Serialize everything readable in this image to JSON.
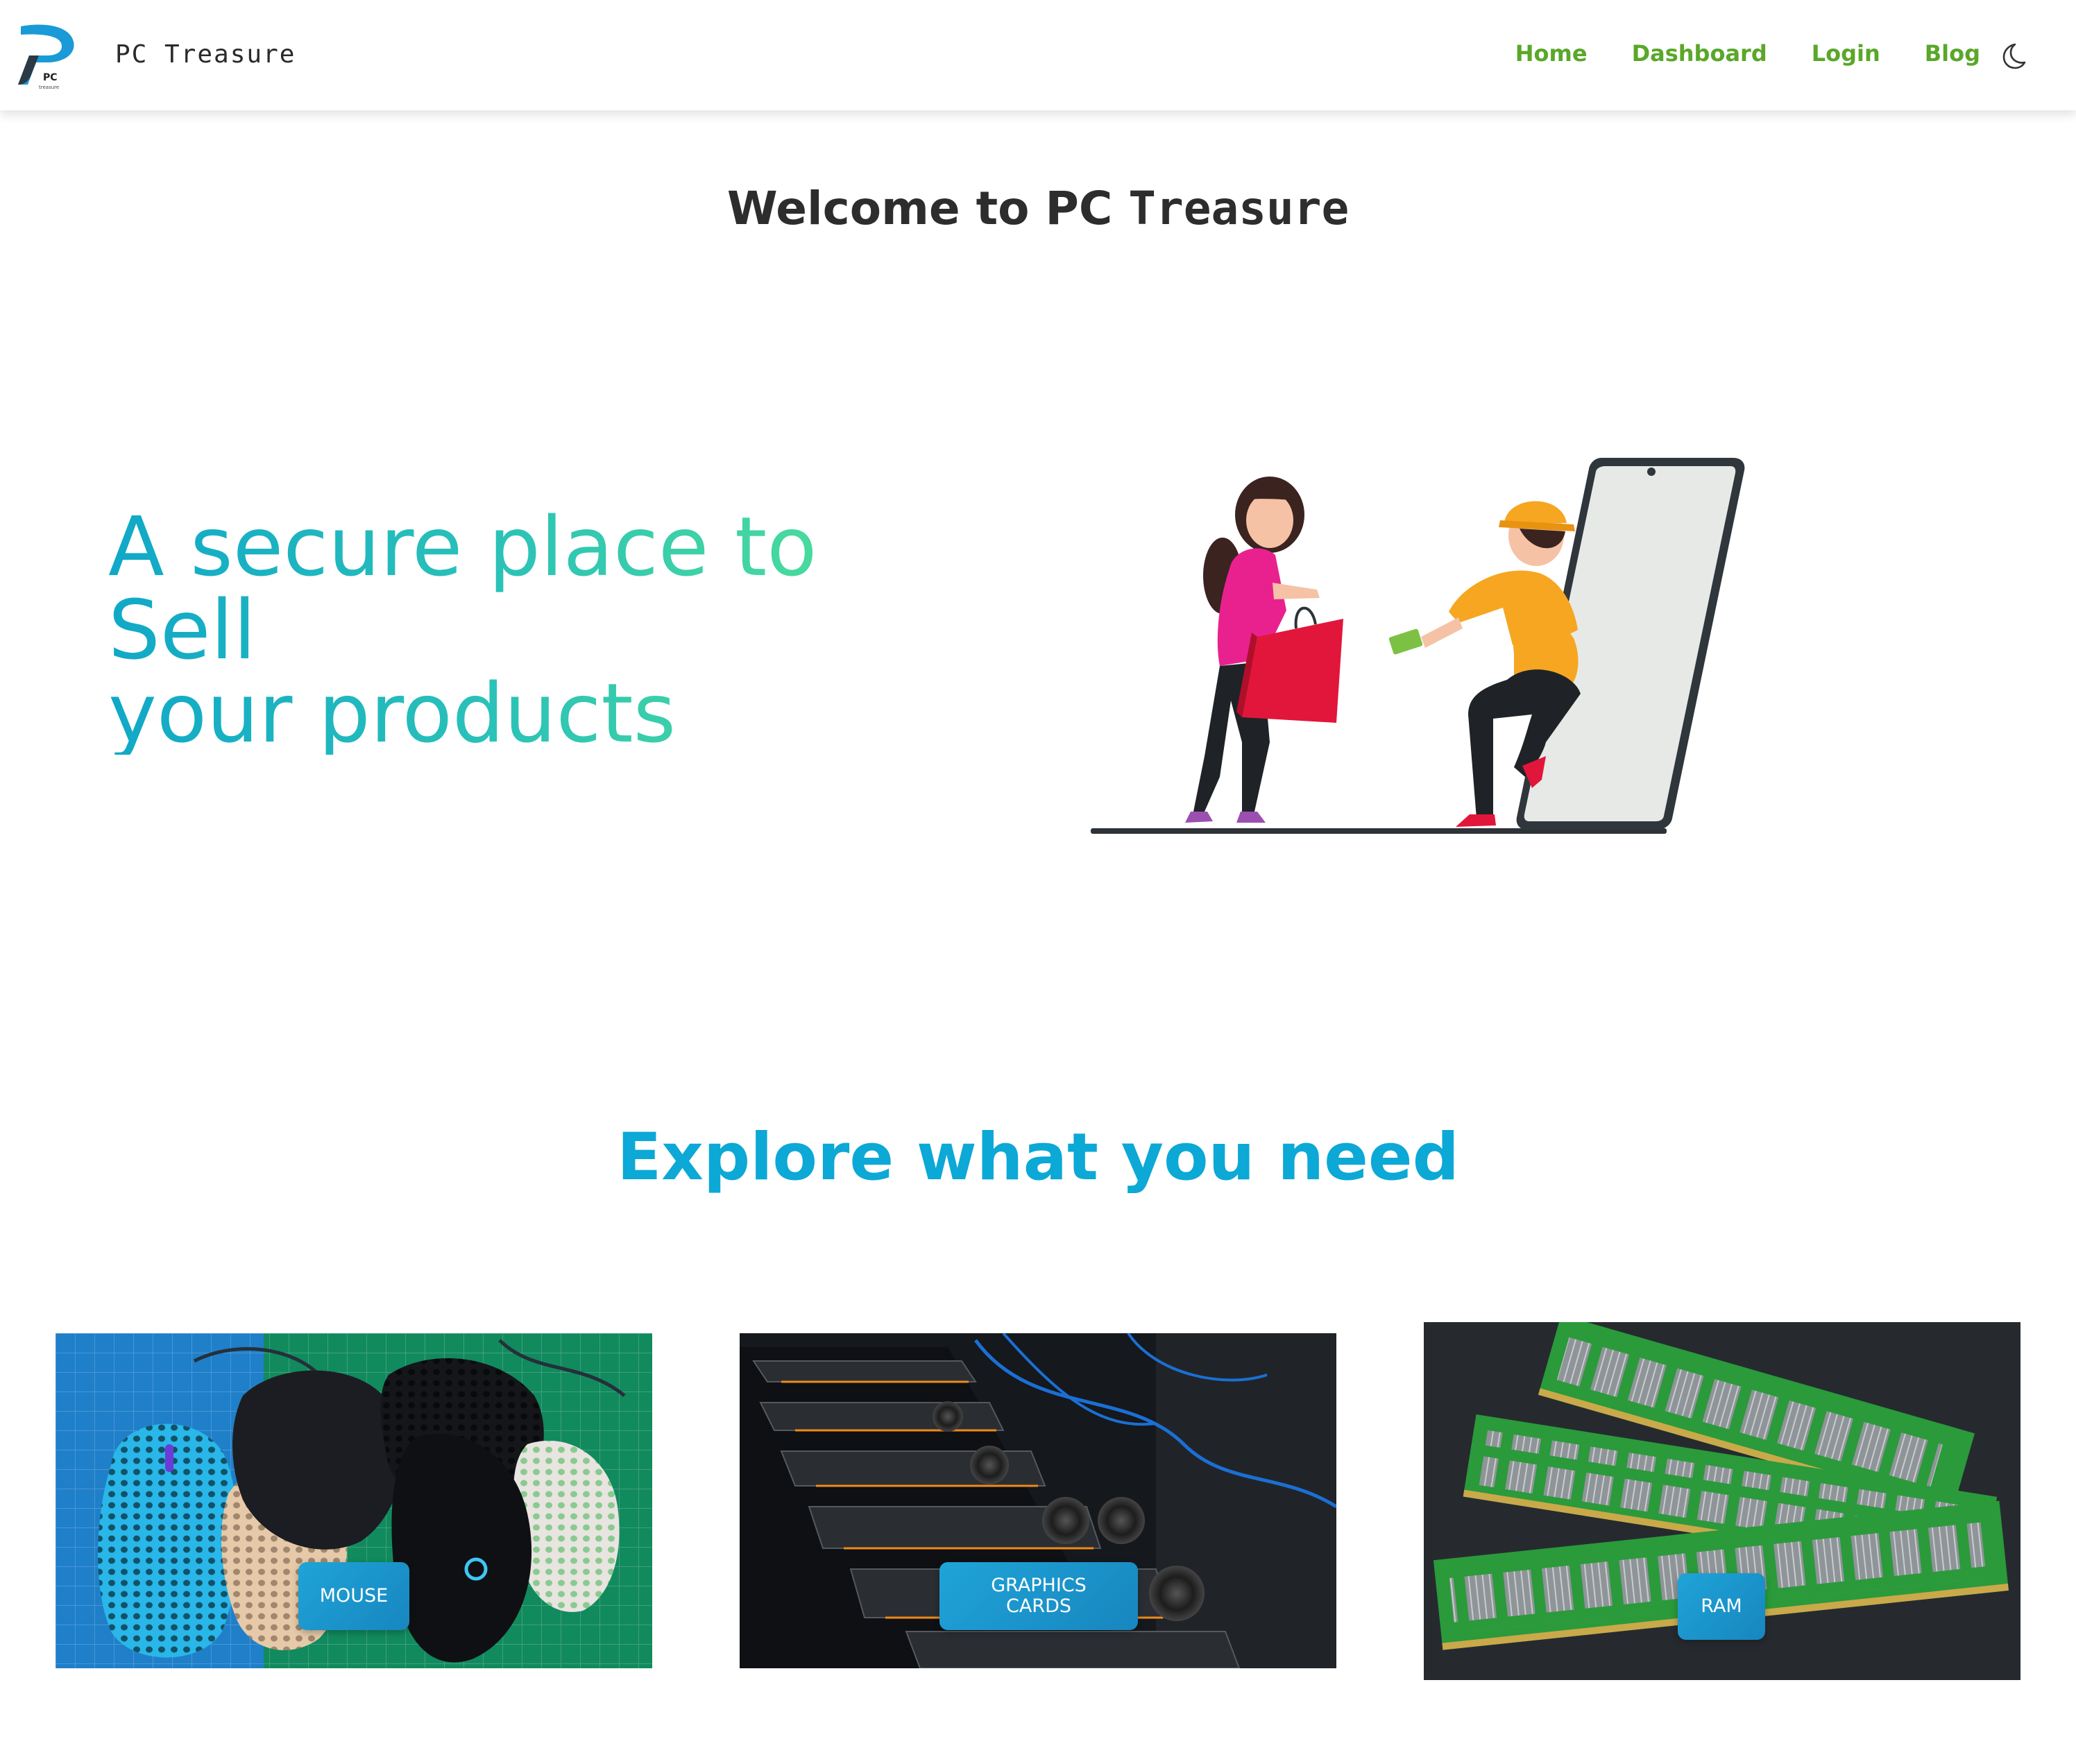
{
  "brand": {
    "name": "PC Treasure",
    "logo_text": "PC",
    "logo_subtext": "treasure"
  },
  "nav": {
    "items": [
      {
        "label": "Home"
      },
      {
        "label": "Dashboard"
      },
      {
        "label": "Login"
      },
      {
        "label": "Blog"
      }
    ],
    "theme_icon": "moon-icon"
  },
  "welcome": {
    "prefix": "Welcome to PC",
    "suffix": "Treasure"
  },
  "hero": {
    "line1": "A secure place to",
    "line2": "Sell",
    "line3": "your products"
  },
  "explore": {
    "title": "Explore what you need",
    "categories": [
      {
        "label": "MOUSE"
      },
      {
        "label_line1": "GRAPHICS",
        "label_line2": "CARDS"
      },
      {
        "label": "RAM"
      }
    ]
  },
  "colors": {
    "nav_link": "#5aa72a",
    "hero_gradient_start": "#10a8c8",
    "hero_gradient_end": "#4bdc9a",
    "explore_title": "#0ca8d6",
    "button_bg": "#1fa4d8"
  }
}
